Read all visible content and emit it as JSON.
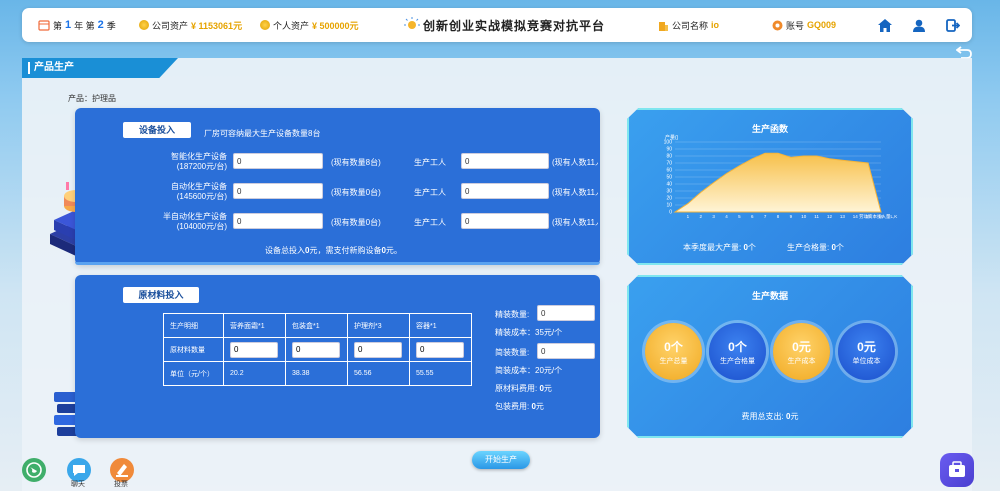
{
  "header": {
    "calendar_pre": "第",
    "year": "1",
    "year_unit": "年 第",
    "season": "2",
    "season_unit": "季",
    "company_assets_label": "公司资产",
    "company_assets_value": "¥ 1153061元",
    "personal_assets_label": "个人资产",
    "personal_assets_value": "¥ 500000元",
    "platform_title": "创新创业实战模拟竞赛对抗平台",
    "company_name_label": "公司名称",
    "company_name_value": "io",
    "account_label": "账号",
    "account_value": "GQ009"
  },
  "section_title": "产品生产",
  "product_label": "产品：护理品",
  "equipment": {
    "button": "设备投入",
    "note": "厂房可容纳最大生产设备数量8台",
    "rows": [
      {
        "label_line1": "智能化生产设备",
        "label_line2": "(187200元/台)",
        "equip_value": "0",
        "existing": "(现有数量8台)",
        "worker_label": "生产工人",
        "worker_value": "0",
        "worker_existing": "(现有人数11人)"
      },
      {
        "label_line1": "自动化生产设备",
        "label_line2": "(145600元/台)",
        "equip_value": "0",
        "existing": "(现有数量0台)",
        "worker_label": "生产工人",
        "worker_value": "0",
        "worker_existing": "(现有人数11人)"
      },
      {
        "label_line1": "半自动化生产设备",
        "label_line2": "(104000元/台)",
        "equip_value": "0",
        "existing": "(现有数量0台)",
        "worker_label": "生产工人",
        "worker_value": "0",
        "worker_existing": "(现有人数11人)"
      }
    ],
    "summary_pre": "设备总投入",
    "summary_value1": "0",
    "summary_mid": "元，需支付新购设备",
    "summary_value2": "0",
    "summary_post": "元。"
  },
  "materials": {
    "button": "原材料投入",
    "headers": [
      "生产明细",
      "营养面霜*1",
      "包装盒*1",
      "护理剂*3",
      "容器*1"
    ],
    "qty_label": "原材料数量",
    "qty_values": [
      "0",
      "0",
      "0",
      "0"
    ],
    "unit_label": "单位（元/个）",
    "unit_values": [
      "20.2",
      "38.38",
      "56.56",
      "55.55"
    ],
    "fine_qty_label": "精装数量:",
    "fine_qty_value": "0",
    "fine_cost": "精装成本：35元/个",
    "simple_qty_label": "简装数量:",
    "simple_qty_value": "0",
    "simple_cost": "简装成本：20元/个",
    "material_fee_label": "原材料费用:",
    "material_fee_value": "0",
    "material_fee_unit": "元",
    "pack_fee_label": "包装费用:",
    "pack_fee_value": "0",
    "pack_fee_unit": "元"
  },
  "production_fn": {
    "title": "生产函数",
    "y_axis_label": "产量()",
    "x_axis_label": "劳动资本投入量L,K",
    "max_output_label": "本季度最大产量:",
    "max_output_value": "0",
    "max_output_unit": "个",
    "qualified_label": "生产合格量:",
    "qualified_value": "0",
    "qualified_unit": "个"
  },
  "chart_data": {
    "type": "area",
    "title": "生产函数",
    "ylabel": "产量()",
    "xlabel": "劳动资本投入量L,K",
    "x": [
      0,
      1,
      2,
      3,
      4,
      5,
      6,
      7,
      8,
      9,
      10,
      11,
      12,
      13,
      14,
      15,
      16
    ],
    "y": [
      0,
      12,
      28,
      42,
      55,
      66,
      76,
      84,
      84,
      78,
      80,
      80,
      76,
      74,
      72,
      70,
      0
    ],
    "ylim": [
      0,
      100
    ],
    "y_ticks": [
      0,
      10,
      20,
      30,
      40,
      50,
      60,
      70,
      80,
      90,
      100
    ],
    "x_ticks": [
      "1",
      "2",
      "3",
      "4",
      "5",
      "6",
      "7",
      "8",
      "9",
      "10",
      "11",
      "12",
      "13",
      "14",
      "15",
      "16"
    ],
    "colors": {
      "fill_top": "#f7c04a",
      "fill_bottom": "#fff4d6",
      "line": "#f4b43a"
    }
  },
  "production_data": {
    "title": "生产数据",
    "circles": [
      {
        "value": "0个",
        "label": "生产总量",
        "style": "gold"
      },
      {
        "value": "0个",
        "label": "生产合格量",
        "style": "blue"
      },
      {
        "value": "0元",
        "label": "生产成本",
        "style": "gold"
      },
      {
        "value": "0元",
        "label": "单位成本",
        "style": "blue"
      }
    ],
    "total_expense_label": "费用总支出:",
    "total_expense_value": "0",
    "total_expense_unit": "元"
  },
  "start_button": "开始生产",
  "bottom": {
    "chat": "聊天",
    "vote": "投票"
  },
  "icons": [
    "calendar-icon",
    "coin-icon",
    "bulb-icon",
    "building-icon",
    "account-icon",
    "home-icon",
    "user-icon",
    "logout-icon",
    "back-icon",
    "globe-icon",
    "chat-icon",
    "vote-icon",
    "toolbox-icon"
  ]
}
